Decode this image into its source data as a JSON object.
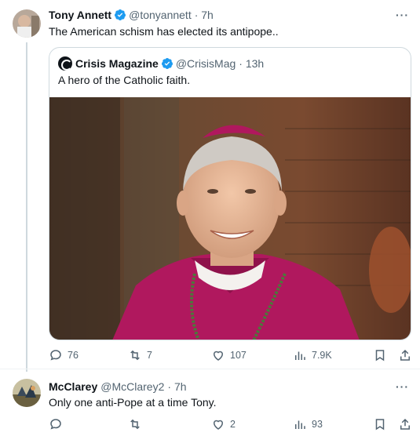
{
  "tweet1": {
    "author_name": "Tony Annett",
    "handle": "@tonyannett",
    "time": "· 7h",
    "text": "The American schism has elected its antipope..",
    "more": "···",
    "quote": {
      "author_name": "Crisis Magazine",
      "handle": "@CrisisMag",
      "time": "· 13h",
      "text": "A hero of the Catholic faith."
    },
    "stats": {
      "replies": "76",
      "reposts": "7",
      "likes": "107",
      "views": "7.9K"
    }
  },
  "tweet2": {
    "author_name": "McClarey",
    "handle": "@McClarey2",
    "time": "· 7h",
    "text": "Only one anti-Pope at a time Tony.",
    "more": "···",
    "stats": {
      "replies": "",
      "reposts": "",
      "likes": "2",
      "views": "93"
    }
  },
  "colors": {
    "verified": "#1d9bf0",
    "muted": "#536471",
    "magenta": "#b0185e"
  }
}
